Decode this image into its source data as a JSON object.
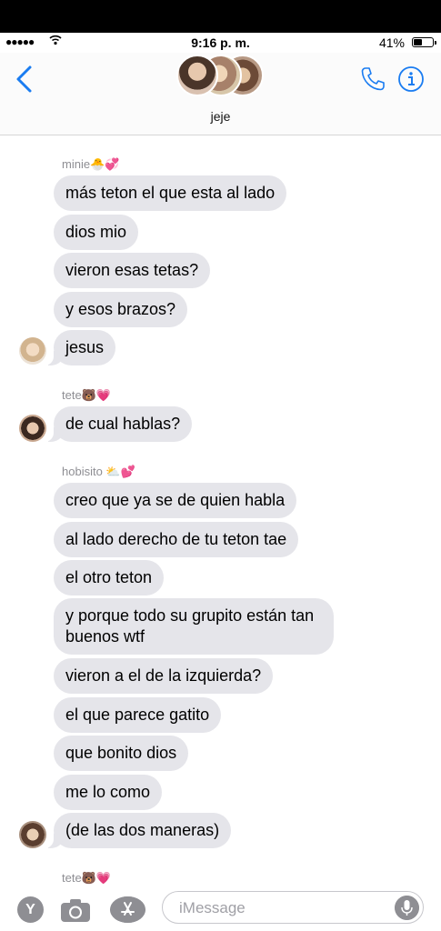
{
  "status": {
    "signal": "●●●●●",
    "time": "9:16 p. m.",
    "battery": "41%"
  },
  "header": {
    "title": "jeje"
  },
  "groups": [
    {
      "sender": "minie🐣💞",
      "messages": [
        "más teton el que esta al lado",
        "dios mio",
        "vieron esas tetas?",
        "y esos brazos?",
        "jesus"
      ]
    },
    {
      "sender": "tete🐻💗",
      "messages": [
        "de cual hablas?"
      ]
    },
    {
      "sender": "hobisito ⛅💕",
      "messages": [
        "creo que ya se de quien habla",
        "al lado derecho de tu teton tae",
        "el otro teton",
        "y porque todo su grupito están tan buenos wtf",
        "vieron a el de la izquierda?",
        "el que parece gatito",
        "que bonito dios",
        "me lo como",
        "(de las dos maneras)"
      ]
    },
    {
      "sender": "tete🐻💗"
    }
  ],
  "input": {
    "placeholder": "iMessage",
    "apps_label": "Y"
  },
  "colors": {
    "accent": "#1a7cf1",
    "bubble": "#e5e5ea",
    "muted": "#8e8e93"
  }
}
